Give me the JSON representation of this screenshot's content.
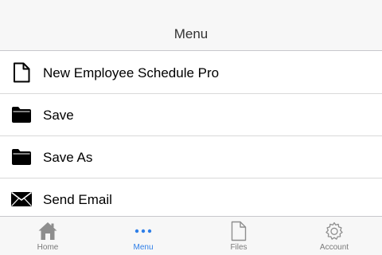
{
  "header": {
    "title": "Menu"
  },
  "menu": {
    "items": [
      {
        "label": "New Employee Schedule Pro",
        "icon": "document-icon"
      },
      {
        "label": "Save",
        "icon": "folder-icon"
      },
      {
        "label": "Save As",
        "icon": "folder-icon"
      },
      {
        "label": "Send Email",
        "icon": "envelope-icon"
      }
    ]
  },
  "tabbar": {
    "active": "Menu",
    "active_color": "#2f7fe8",
    "inactive_color": "#7a7a7a",
    "tabs": [
      {
        "label": "Home",
        "icon": "home-icon"
      },
      {
        "label": "Menu",
        "icon": "more-dots-icon"
      },
      {
        "label": "Files",
        "icon": "file-icon"
      },
      {
        "label": "Account",
        "icon": "gear-icon"
      }
    ]
  }
}
